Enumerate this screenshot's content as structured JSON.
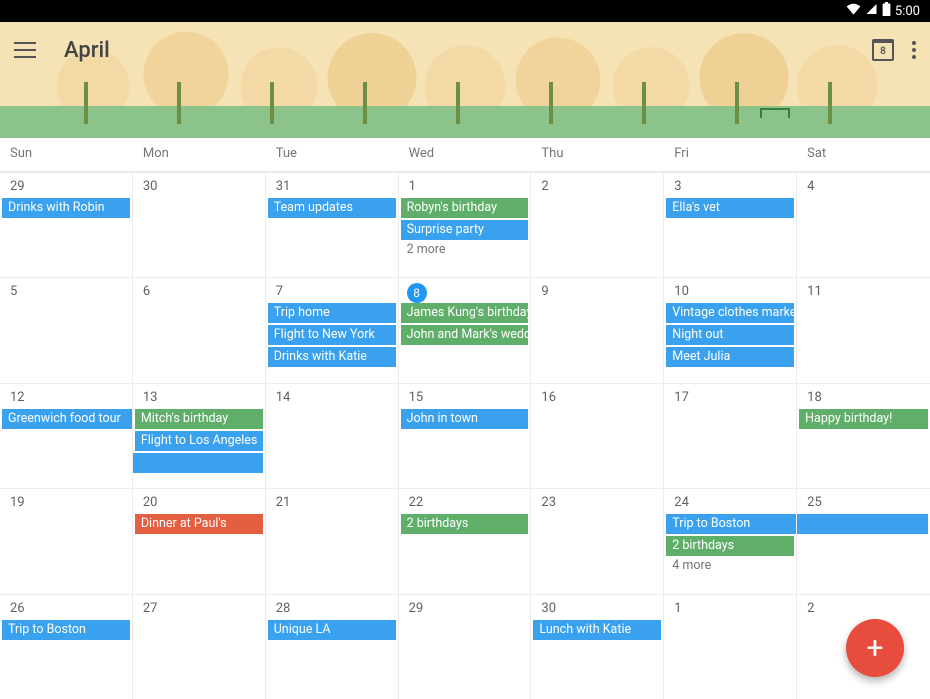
{
  "status": {
    "time": "5:00"
  },
  "header": {
    "title": "April",
    "today_chip": "8"
  },
  "dow": [
    "Sun",
    "Mon",
    "Tue",
    "Wed",
    "Thu",
    "Fri",
    "Sat"
  ],
  "weeks": [
    [
      {
        "n": "29",
        "events": [
          {
            "label": "Drinks with Robin",
            "color": "blue"
          }
        ]
      },
      {
        "n": "30",
        "events": []
      },
      {
        "n": "31",
        "events": [
          {
            "label": "Team updates",
            "color": "blue"
          }
        ]
      },
      {
        "n": "1",
        "events": [
          {
            "label": "Robyn's birthday",
            "color": "green"
          },
          {
            "label": "Surprise party",
            "color": "blue"
          }
        ],
        "more": "2 more"
      },
      {
        "n": "2",
        "events": []
      },
      {
        "n": "3",
        "events": [
          {
            "label": "Ella's vet",
            "color": "blue"
          }
        ]
      },
      {
        "n": "4",
        "events": []
      }
    ],
    [
      {
        "n": "5",
        "events": []
      },
      {
        "n": "6",
        "events": []
      },
      {
        "n": "7",
        "events": [
          {
            "label": "Trip home",
            "color": "blue"
          },
          {
            "label": "Flight to New York",
            "color": "blue"
          },
          {
            "label": "Drinks with Katie",
            "color": "blue"
          }
        ]
      },
      {
        "n": "8",
        "today": true,
        "events": [
          {
            "label": "James Kung's birthday",
            "color": "green"
          },
          {
            "label": "John and Mark's wedding",
            "color": "green"
          }
        ]
      },
      {
        "n": "9",
        "events": []
      },
      {
        "n": "10",
        "events": [
          {
            "label": "Vintage clothes market",
            "color": "blue"
          },
          {
            "label": "Night out",
            "color": "blue"
          },
          {
            "label": "Meet Julia",
            "color": "blue"
          }
        ]
      },
      {
        "n": "11",
        "events": []
      }
    ],
    [
      {
        "n": "12",
        "events": [
          {
            "label": "Greenwich food tour",
            "color": "blue",
            "span": "right"
          }
        ]
      },
      {
        "n": "13",
        "events": [
          {
            "label": "Mitch's birthday",
            "color": "green"
          },
          {
            "label": "Flight to Los Angeles",
            "color": "blue"
          },
          {
            "label": "",
            "color": "blue",
            "continuation": true,
            "span": "left"
          }
        ]
      },
      {
        "n": "14",
        "events": []
      },
      {
        "n": "15",
        "events": [
          {
            "label": "John in town",
            "color": "blue"
          }
        ]
      },
      {
        "n": "16",
        "events": []
      },
      {
        "n": "17",
        "events": []
      },
      {
        "n": "18",
        "events": [
          {
            "label": "Happy birthday!",
            "color": "green"
          }
        ]
      }
    ],
    [
      {
        "n": "19",
        "events": []
      },
      {
        "n": "20",
        "events": [
          {
            "label": "Dinner at Paul's",
            "color": "orange"
          }
        ]
      },
      {
        "n": "21",
        "events": []
      },
      {
        "n": "22",
        "events": [
          {
            "label": "2 birthdays",
            "color": "green"
          }
        ]
      },
      {
        "n": "23",
        "events": []
      },
      {
        "n": "24",
        "events": [
          {
            "label": "Trip to Boston",
            "color": "blue",
            "span": "right"
          },
          {
            "label": "2 birthdays",
            "color": "green"
          }
        ],
        "more": "4 more"
      },
      {
        "n": "25",
        "events": [
          {
            "label": "",
            "color": "blue",
            "span": "left",
            "continuation": true
          }
        ]
      }
    ],
    [
      {
        "n": "26",
        "events": [
          {
            "label": "Trip to Boston",
            "color": "blue"
          }
        ]
      },
      {
        "n": "27",
        "events": []
      },
      {
        "n": "28",
        "events": [
          {
            "label": "Unique LA",
            "color": "blue"
          }
        ]
      },
      {
        "n": "29",
        "events": []
      },
      {
        "n": "30",
        "events": [
          {
            "label": "Lunch with Katie",
            "color": "blue"
          }
        ]
      },
      {
        "n": "1",
        "events": []
      },
      {
        "n": "2",
        "events": []
      }
    ]
  ],
  "fab": {
    "glyph": "+"
  }
}
